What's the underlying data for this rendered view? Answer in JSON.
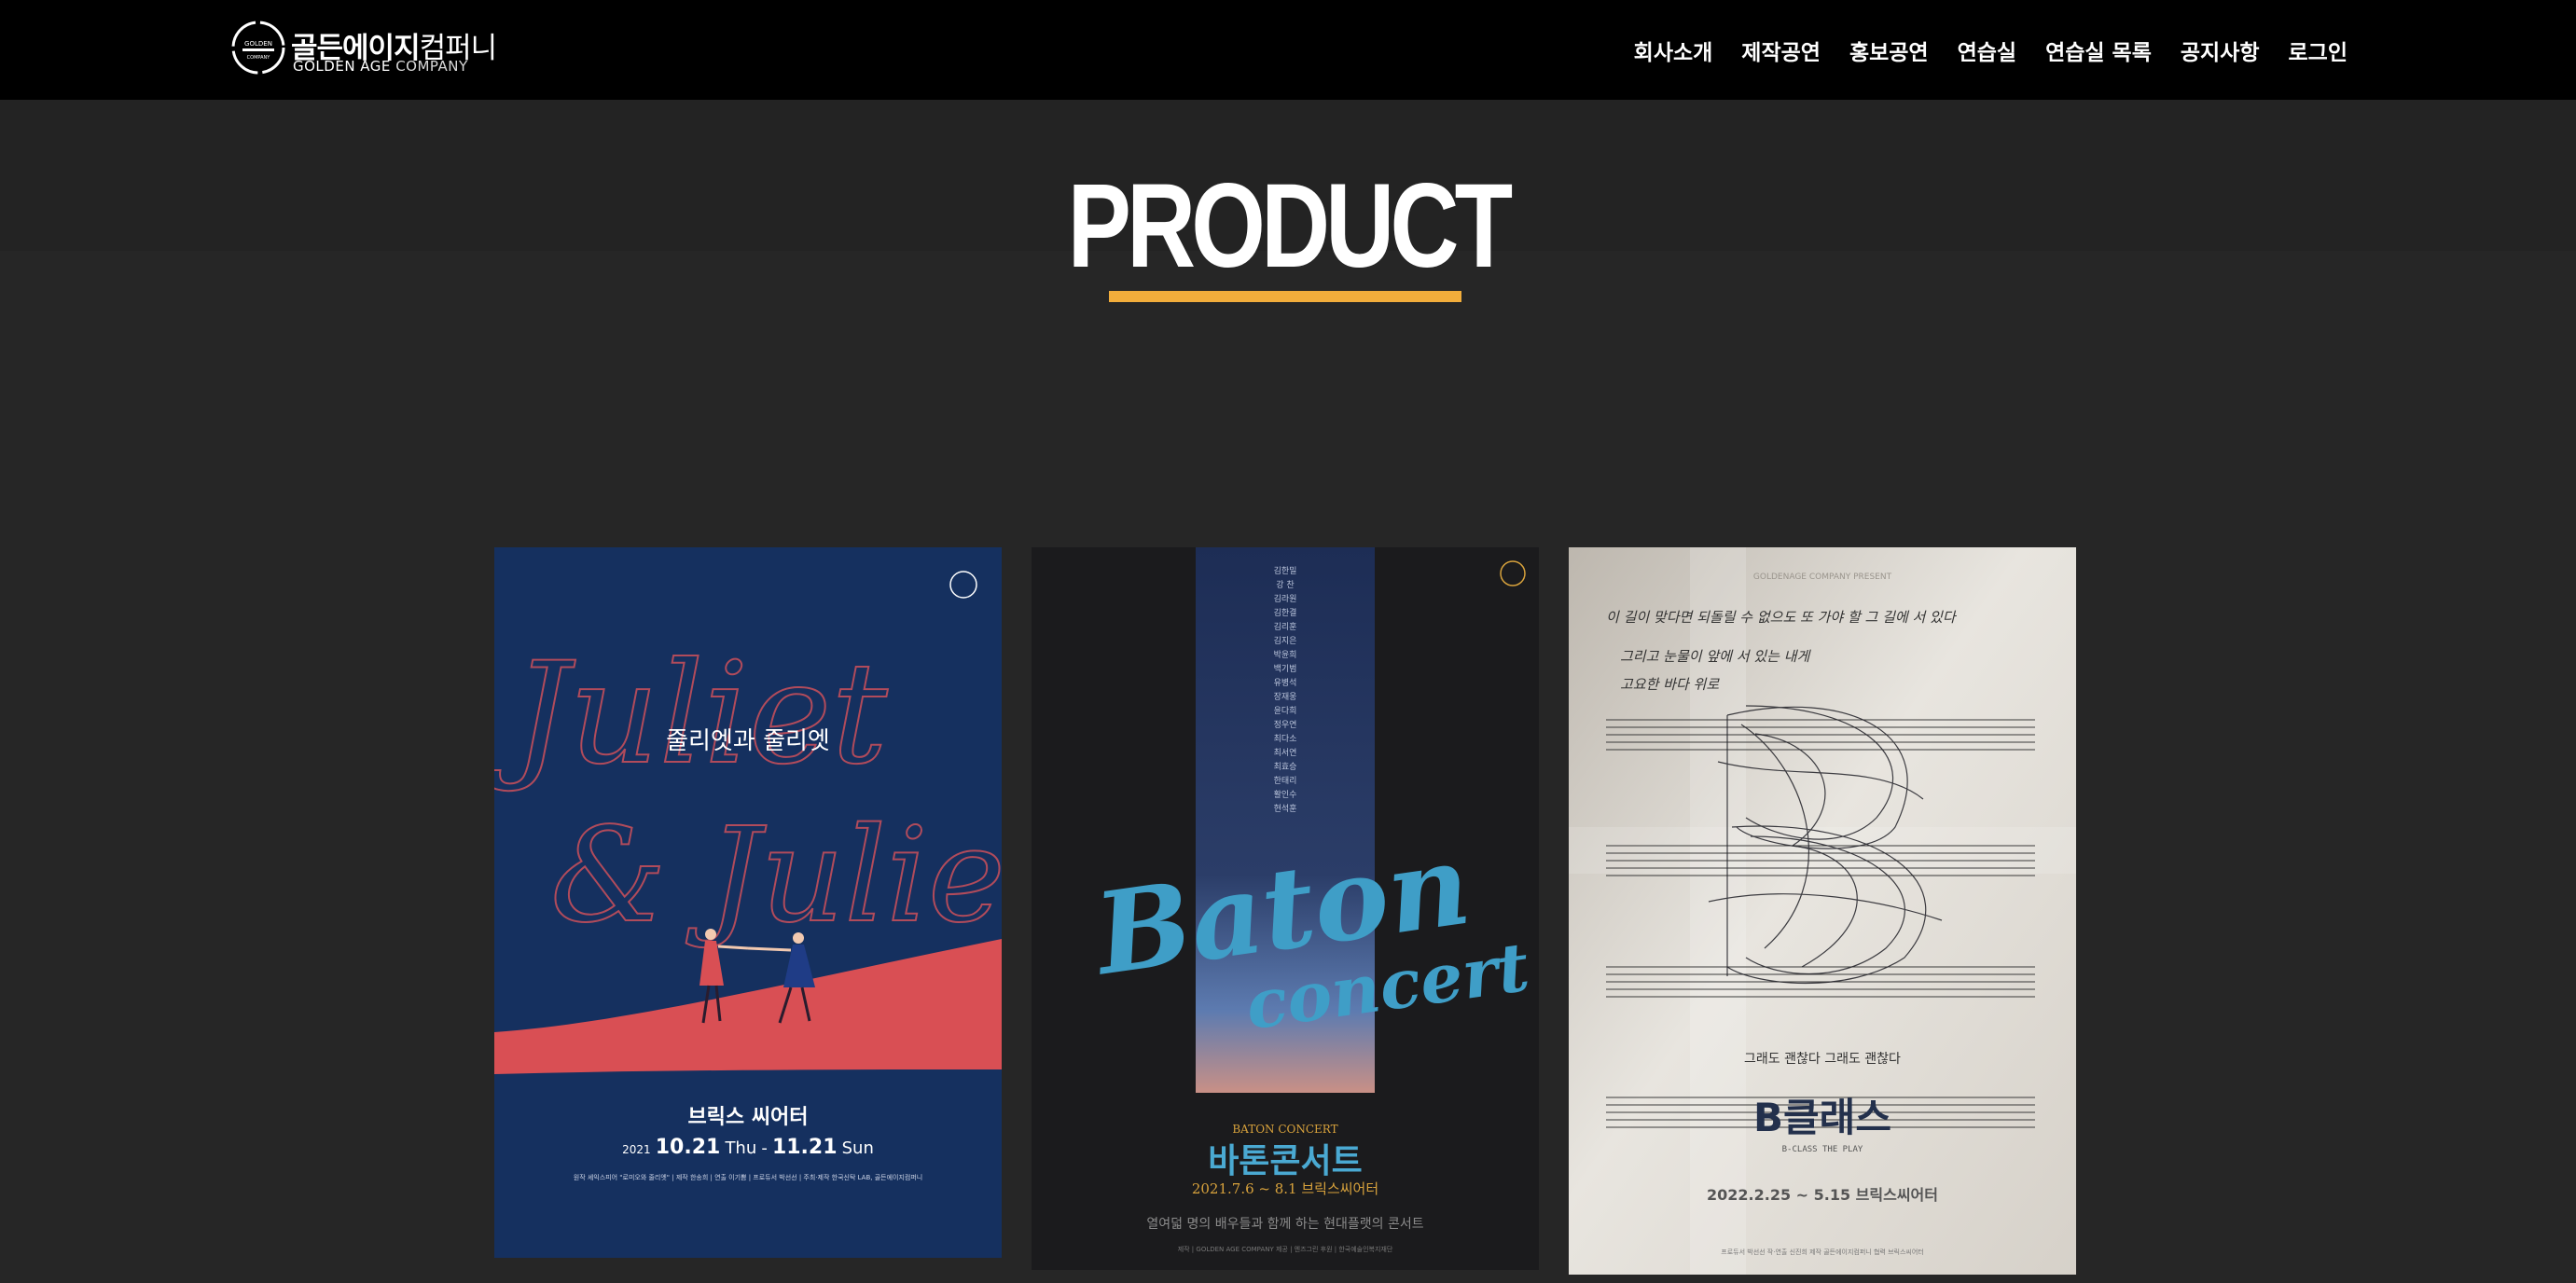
{
  "header": {
    "logo": {
      "ko_bold": "골든에이지",
      "ko_light": "컴퍼니",
      "en_bold": "GOLDEN AGE",
      "en_light": "COMPANY"
    },
    "nav": [
      "회사소개",
      "제작공연",
      "홍보공연",
      "연습실",
      "연습실 목록",
      "공지사항",
      "로그인"
    ]
  },
  "page": {
    "title": "PRODUCT"
  },
  "colors": {
    "accent": "#f2ad3b",
    "background": "#262626",
    "header": "#000000"
  },
  "products": [
    {
      "title": "줄리엣과 줄리엣",
      "script": [
        "Juliet",
        "& Juliet"
      ],
      "venue": "브릭스 씨어터",
      "year": "2021",
      "date_start": "10.21",
      "day_start": "Thu",
      "date_sep": "-",
      "date_end": "11.21",
      "day_end": "Sun",
      "credits": "원작 셰익스피어 \"로미오와 줄리엣\" | 제작 한송희 | 연출 이기쁨 | 프로듀서 박선선 | 주최·제작 한국신탁 LAB, 골든에이지컴퍼니"
    },
    {
      "title": "바톤콘서트",
      "script": [
        "Baton",
        "concert"
      ],
      "eyebrow": "BATON CONCERT",
      "dates": "2021.7.6 ~ 8.1 브릭스씨어터",
      "tagline": "열여덟 명의 배우들과 함께 하는 현대플랫의 콘서트",
      "cast": [
        "김한밀",
        "강 찬",
        "김라원",
        "김한결",
        "김리훈",
        "김지은",
        "박윤희",
        "백기범",
        "유병석",
        "장재웅",
        "윤다희",
        "정우연",
        "최다소",
        "최서연",
        "최효승",
        "한태리",
        "활인수",
        "현석훈"
      ],
      "credits": "제작 | GOLDEN AGE COMPANY  제공 | 엔즈그린  후원 | 한국예술인복지재단"
    },
    {
      "title": "B클래스",
      "subtitle": "B-CLASS THE PLAY",
      "presenter": "GOLDENAGE COMPANY PRESENT",
      "tagline": "그래도 괜찮다 그래도 괜찮다",
      "dates": "2022.2.25 ~ 5.15 브릭스씨어터",
      "handwriting": [
        "이 길이 맞다면 되돌릴 수 없으도 또 가야 할 그 길에 서 있다",
        "그리고 눈물이 앞에 서 있는 내게",
        "고요한 바다 위로"
      ],
      "credits": "프로듀서 박선선  작·연출 신진희  제작 골든에이지컴퍼니  협력 브릭스씨어터"
    }
  ]
}
